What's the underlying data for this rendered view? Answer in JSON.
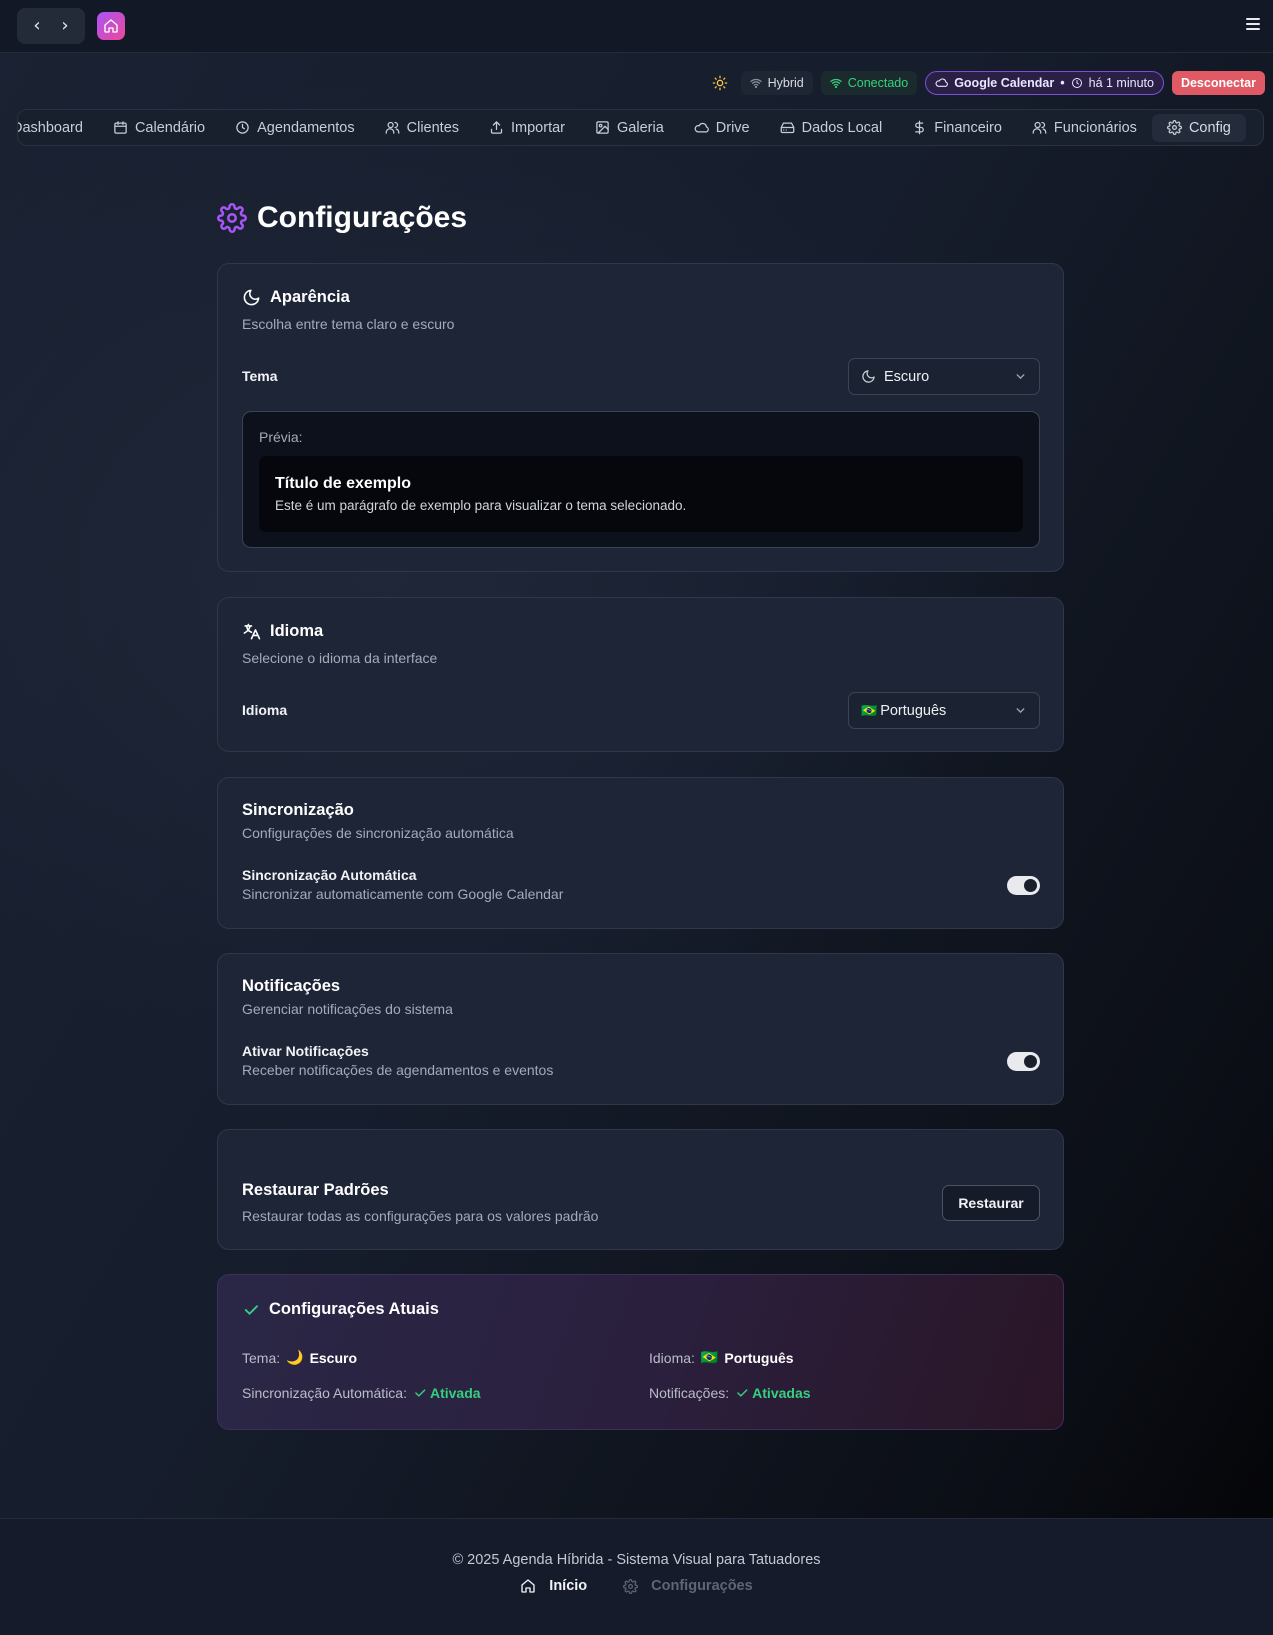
{
  "nav": {
    "back_icon": "‹",
    "forward_icon": "›"
  },
  "status": {
    "mode": "Hybrid",
    "connection": "Conectado",
    "calendar": "Google Calendar",
    "calendar_separator": "•",
    "last_sync": "há 1 minuto",
    "disconnect": "Desconectar"
  },
  "tabs": [
    {
      "label": "Dashboard",
      "icon": "dashboard-icon"
    },
    {
      "label": "Calendário",
      "icon": "calendar-icon"
    },
    {
      "label": "Agendamentos",
      "icon": "clock-icon"
    },
    {
      "label": "Clientes",
      "icon": "users-icon"
    },
    {
      "label": "Importar",
      "icon": "upload-icon"
    },
    {
      "label": "Galeria",
      "icon": "image-icon"
    },
    {
      "label": "Drive",
      "icon": "cloud-icon"
    },
    {
      "label": "Dados Local",
      "icon": "hard-drive-icon"
    },
    {
      "label": "Financeiro",
      "icon": "dollar-icon"
    },
    {
      "label": "Funcionários",
      "icon": "users-icon"
    },
    {
      "label": "Config",
      "icon": "gear-icon"
    }
  ],
  "page": {
    "title": "Configurações"
  },
  "appearance": {
    "title": "Aparência",
    "subtitle": "Escolha entre tema claro e escuro",
    "theme_label": "Tema",
    "theme_value": "Escuro",
    "preview_label": "Prévia:",
    "preview_title": "Título de exemplo",
    "preview_text": "Este é um parágrafo de exemplo para visualizar o tema selecionado."
  },
  "language": {
    "title": "Idioma",
    "subtitle": "Selecione o idioma da interface",
    "label": "Idioma",
    "value": "Português",
    "flag": "🇧🇷"
  },
  "sync": {
    "title": "Sincronização",
    "subtitle": "Configurações de sincronização automática",
    "option_title": "Sincronização Automática",
    "option_desc": "Sincronizar automaticamente com Google Calendar",
    "enabled": true
  },
  "notifications": {
    "title": "Notificações",
    "subtitle": "Gerenciar notificações do sistema",
    "option_title": "Ativar Notificações",
    "option_desc": "Receber notificações de agendamentos e eventos",
    "enabled": true
  },
  "restore": {
    "title": "Restaurar Padrões",
    "subtitle": "Restaurar todas as configurações para os valores padrão",
    "button": "Restaurar"
  },
  "summary": {
    "title": "Configurações Atuais",
    "theme_label": "Tema:",
    "theme_emoji": "🌙",
    "theme_value": "Escuro",
    "language_label": "Idioma:",
    "language_flag": "🇧🇷",
    "language_value": "Português",
    "sync_label": "Sincronização Automática:",
    "sync_value": "Ativada",
    "notif_label": "Notificações:",
    "notif_value": "Ativadas"
  },
  "footer": {
    "copyright": "© 2025 Agenda Híbrida - Sistema Visual para Tatuadores",
    "home_link": "Início",
    "config_link": "Configurações"
  },
  "colors": {
    "accent": "#a855f7",
    "success": "#35d07f",
    "danger": "#e05a66"
  }
}
